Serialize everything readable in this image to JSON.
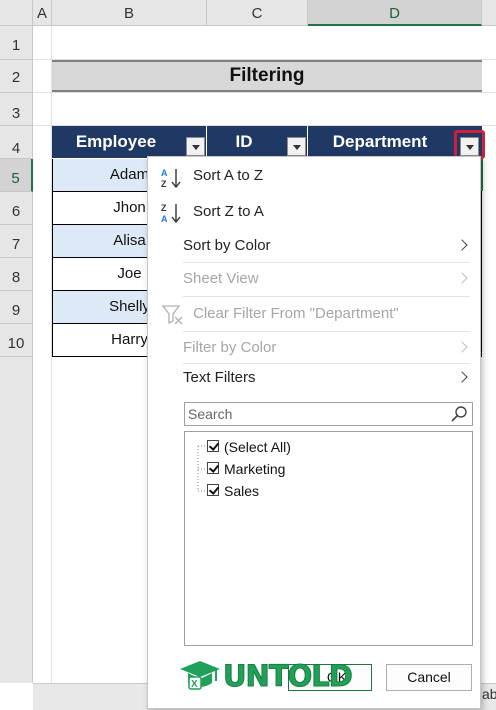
{
  "columns": [
    "A",
    "B",
    "C",
    "D"
  ],
  "rows": [
    "1",
    "2",
    "3",
    "4",
    "5",
    "6",
    "7",
    "8",
    "9",
    "10"
  ],
  "title": "Filtering",
  "table": {
    "headers": [
      "Employee",
      "ID",
      "Department"
    ],
    "employees": [
      "Adam",
      "Jhon",
      "Alisa",
      "Joe",
      "Shelly",
      "Harry"
    ]
  },
  "menu": {
    "sort_az": "Sort A to Z",
    "sort_za": "Sort Z to A",
    "sort_color": "Sort by Color",
    "sheet_view": "Sheet View",
    "clear_filter": "Clear Filter From \"Department\"",
    "filter_color": "Filter by Color",
    "text_filters": "Text Filters",
    "search_placeholder": "Search",
    "list": [
      "(Select All)",
      "Marketing",
      "Sales"
    ],
    "ok": "OK",
    "cancel": "Cancel"
  },
  "watermark": "UNTOLD",
  "sheet_tab_fragment": "ab",
  "colors": {
    "header_bg": "#203864",
    "alt_row": "#dde9f6",
    "highlight": "#d21f3c",
    "brand": "#21a05a"
  }
}
